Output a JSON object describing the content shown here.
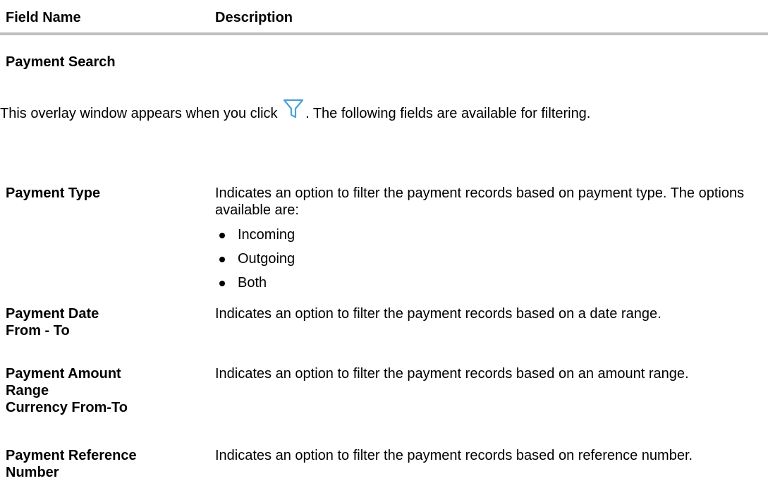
{
  "header": {
    "col_field": "Field Name",
    "col_description": "Description"
  },
  "section": {
    "title": "Payment Search",
    "intro_before_icon": "This overlay window appears when you click ",
    "intro_after_icon": ". The following fields are available for filtering.",
    "icon": "filter-funnel-icon",
    "icon_color": "#4a9fd5"
  },
  "rows": [
    {
      "field_lines": [
        "Payment Type"
      ],
      "description": "Indicates an option to filter the payment records based on payment type. The options available are:",
      "options": [
        "Incoming",
        "Outgoing",
        "Both"
      ]
    },
    {
      "field_lines": [
        "Payment Date",
        "From - To"
      ],
      "description": "Indicates an option to filter the payment records based on a date range."
    },
    {
      "field_lines": [
        "Payment Amount",
        "Range",
        "Currency From-To"
      ],
      "description": "Indicates an option to filter the payment records based on an amount range."
    },
    {
      "field_lines": [
        "Payment Reference",
        "Number"
      ],
      "description": "Indicates an option to filter the payment records based on reference number."
    }
  ]
}
